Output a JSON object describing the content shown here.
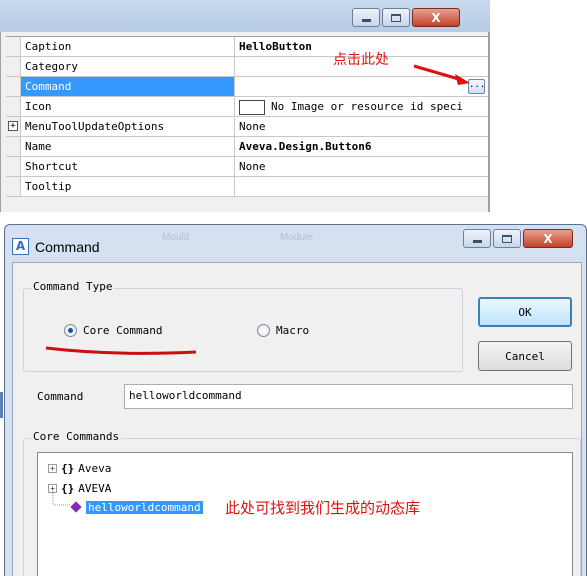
{
  "top_window": {
    "properties": [
      {
        "name": "Caption",
        "value": "HelloButton",
        "bold": true
      },
      {
        "name": "Category",
        "value": ""
      },
      {
        "name": "Command",
        "value": "",
        "selected": true,
        "ellipsis": "..."
      },
      {
        "name": "Icon",
        "value": "No Image or resource id speci"
      },
      {
        "name": "MenuToolUpdateOptions",
        "value": "None",
        "expander": "+"
      },
      {
        "name": "Name",
        "value": "Aveva.Design.Button6",
        "bold": true
      },
      {
        "name": "Shortcut",
        "value": "None"
      },
      {
        "name": "Tooltip",
        "value": ""
      }
    ],
    "annotation_click_here": "点击此处"
  },
  "dialog": {
    "title": "Command",
    "app_icon_glyph": "A",
    "ghost_texts": [
      "Mould",
      "Module"
    ],
    "command_type": {
      "label": "Command Type",
      "options": [
        {
          "label": "Core Command",
          "checked": true
        },
        {
          "label": "Macro",
          "checked": false
        }
      ]
    },
    "ok_label": "OK",
    "cancel_label": "Cancel",
    "command_field_label": "Command",
    "command_field_value": "helloworldcommand",
    "core_commands": {
      "label": "Core Commands",
      "nodes": [
        {
          "label": "Aveva",
          "prefix": "{}",
          "expander": "+"
        },
        {
          "label": "AVEVA",
          "prefix": "{}",
          "expander": "+"
        },
        {
          "label": "helloworldcommand",
          "selected": true
        }
      ]
    },
    "annotation_dynamic_lib": "此处可找到我们生成的动态库"
  },
  "colors": {
    "annotation_red": "#e01010",
    "selection_blue": "#3399ff",
    "title_bar": "#c9d9ee"
  }
}
